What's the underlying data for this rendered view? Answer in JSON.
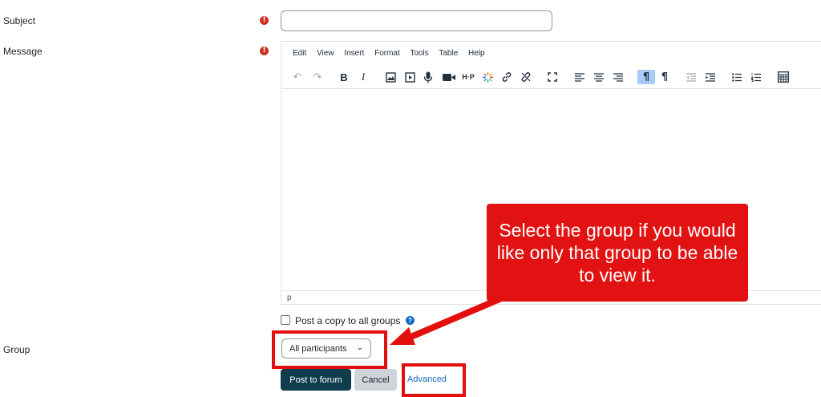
{
  "form": {
    "subject_label": "Subject",
    "message_label": "Message",
    "group_label": "Group",
    "required_mark": "!",
    "subject_value": ""
  },
  "editor": {
    "menu": [
      "Edit",
      "View",
      "Insert",
      "Format",
      "Tools",
      "Table",
      "Help"
    ],
    "toolbar_icons": [
      "undo-icon",
      "redo-icon",
      "bold-icon",
      "italic-icon",
      "image-icon",
      "media-icon",
      "record-audio-icon",
      "record-video-icon",
      "h5p-icon",
      "multimedia-icon",
      "link-icon",
      "unlink-icon",
      "fullscreen-icon",
      "align-left-icon",
      "align-center-icon",
      "align-right-icon",
      "ltr-icon",
      "rtl-icon",
      "outdent-icon",
      "indent-icon",
      "bullet-list-icon",
      "numbered-list-icon",
      "calculator-icon"
    ],
    "toolbar_glyphs": {
      "bold": "B",
      "italic": "I",
      "h5p": "H·P",
      "ltr": "¶",
      "rtl": "¶"
    },
    "status_path": "p"
  },
  "options": {
    "post_copy_label": "Post a copy to all groups",
    "help_glyph": "?"
  },
  "group_select": {
    "selected": "All participants",
    "chevron": "⌄"
  },
  "buttons": {
    "post": "Post to forum",
    "cancel": "Cancel",
    "advanced": "Advanced"
  },
  "annotation": {
    "text": "Select the group if you would like only that group to be able to view it.",
    "color": "#e31212"
  },
  "colors": {
    "primary": "#0f3d4d",
    "link": "#0f6cbf",
    "required": "#ca3120",
    "highlight": "#e30f0f"
  }
}
